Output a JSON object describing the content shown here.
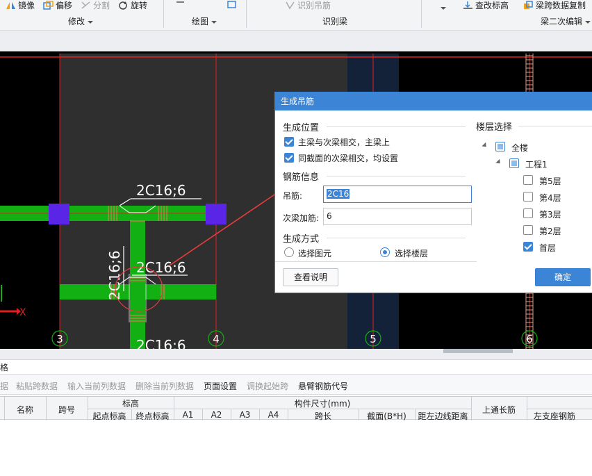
{
  "ribbon": {
    "modify": {
      "mirror": "镜像",
      "offset": "偏移",
      "split": "分割",
      "rotate": "旋转",
      "group_label": "修改"
    },
    "draw": {
      "group_label": "绘图"
    },
    "identify": {
      "identify_hanger": "识别吊筋",
      "group_label": "识别梁"
    },
    "secondary_edit": {
      "check_elevation": "查改标高",
      "copy_span_data": "梁跨数据复制",
      "group_label": "梁二次编辑"
    }
  },
  "canvas": {
    "rebar_labels": [
      "2C16;6",
      "2C16;6",
      "2C16;6",
      "2C16;6"
    ],
    "axis_numbers": [
      "3",
      "4",
      "5",
      "6"
    ],
    "axis_x_label": "X",
    "colors": {
      "beam": "#12b012",
      "column": "#5a25e6",
      "grid_line": "#e02020",
      "highlight_column": "#132238",
      "annotation": "#e23c3c"
    }
  },
  "dialog": {
    "title": "生成吊筋",
    "position_section": "生成位置",
    "opt_main_secondary": "主梁与次梁相交，主梁上",
    "opt_main_secondary_checked": true,
    "opt_same_section": "同截面的次梁相交，均设置",
    "opt_same_section_checked": true,
    "rebar_section": "钢筋信息",
    "hanger_label": "吊筋:",
    "hanger_value": "2C16",
    "secondary_add_label": "次梁加筋:",
    "secondary_add_value": "6",
    "method_section": "生成方式",
    "method_select_elements": "选择图元",
    "method_select_floors": "选择楼层",
    "method_selected": "选择楼层",
    "floor_section": "楼层选择",
    "tree": {
      "all": "全楼",
      "project": "工程1",
      "floors": [
        {
          "name": "第5层",
          "checked": false
        },
        {
          "name": "第4层",
          "checked": false
        },
        {
          "name": "第3层",
          "checked": false
        },
        {
          "name": "第2层",
          "checked": false
        },
        {
          "name": "首层",
          "checked": true
        }
      ]
    },
    "help_button": "查看说明",
    "ok_button": "确定"
  },
  "panel": {
    "title_fragment": "格",
    "tools": [
      {
        "label": "据",
        "enabled": false
      },
      {
        "label": "粘贴跨数据",
        "enabled": false
      },
      {
        "label": "输入当前列数据",
        "enabled": false
      },
      {
        "label": "删除当前列数据",
        "enabled": false
      },
      {
        "label": "页面设置",
        "enabled": true
      },
      {
        "label": "调换起始跨",
        "enabled": false
      },
      {
        "label": "悬臂钢筋代号",
        "enabled": true
      }
    ],
    "columns": {
      "name": "名称",
      "span_no": "跨号",
      "elevation": "标高",
      "start_elev": "起点标高",
      "end_elev": "终点标高",
      "member_size": "构件尺寸(mm)",
      "a1": "A1",
      "a2": "A2",
      "a3": "A3",
      "a4": "A4",
      "span_length": "跨长",
      "section": "截面(B*H)",
      "dist_left_edge": "距左边线距离",
      "top_long_bar": "上通长筋",
      "left_support_bar": "左支座钢筋"
    }
  }
}
